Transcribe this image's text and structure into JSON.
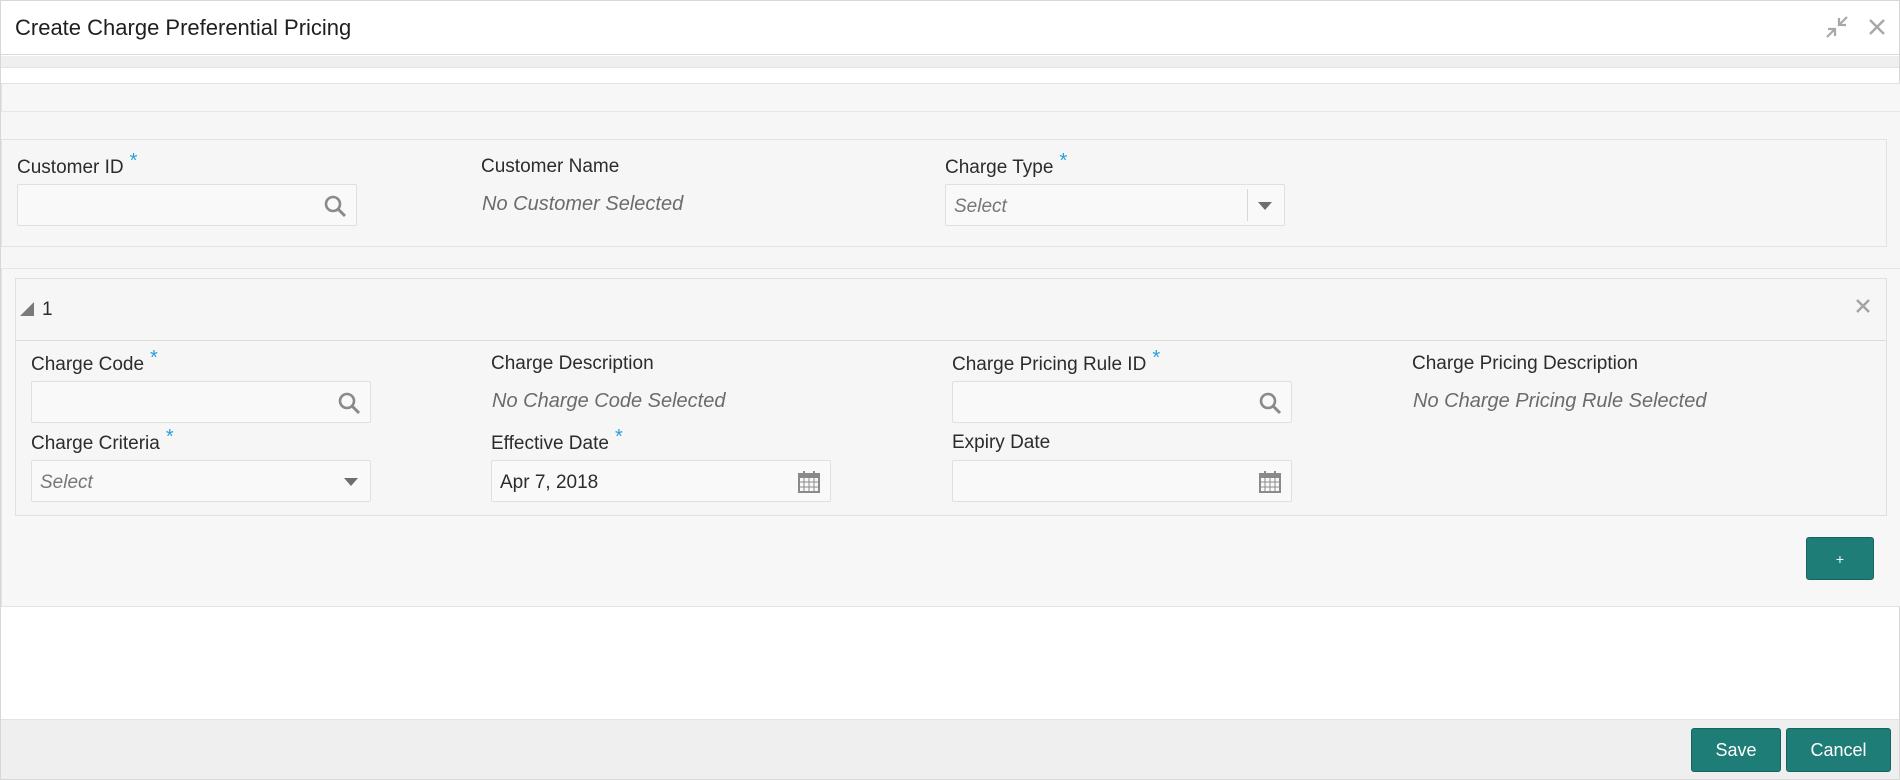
{
  "window": {
    "title": "Create Charge Preferential Pricing",
    "minimize_icon": "collapse-arrows-icon",
    "close_icon": "close-icon"
  },
  "header": {
    "customer_id": {
      "label": "Customer ID",
      "required": "*",
      "value": "",
      "icon": "search-icon"
    },
    "customer_name": {
      "label": "Customer Name",
      "value": "No Customer Selected"
    },
    "charge_type": {
      "label": "Charge Type",
      "required": "*",
      "placeholder": "Select",
      "icon": "chevron-down-icon"
    }
  },
  "rows": [
    {
      "number": "1",
      "charge_code": {
        "label": "Charge Code",
        "required": "*",
        "value": "",
        "icon": "search-icon"
      },
      "charge_description": {
        "label": "Charge Description",
        "value": "No Charge Code Selected"
      },
      "charge_pricing_rule_id": {
        "label": "Charge Pricing Rule ID",
        "required": "*",
        "value": "",
        "icon": "search-icon"
      },
      "charge_pricing_description": {
        "label": "Charge Pricing Description",
        "value": "No Charge Pricing Rule Selected"
      },
      "charge_criteria": {
        "label": "Charge Criteria",
        "required": "*",
        "placeholder": "Select",
        "icon": "chevron-down-icon"
      },
      "effective_date": {
        "label": "Effective Date",
        "required": "*",
        "value": "Apr 7, 2018",
        "icon": "calendar-icon"
      },
      "expiry_date": {
        "label": "Expiry Date",
        "value": "",
        "icon": "calendar-icon"
      }
    }
  ],
  "actions": {
    "add_row_label": "+",
    "save_label": "Save",
    "cancel_label": "Cancel"
  },
  "colors": {
    "accent": "#1f7d78",
    "required": "#2a9fd6"
  }
}
